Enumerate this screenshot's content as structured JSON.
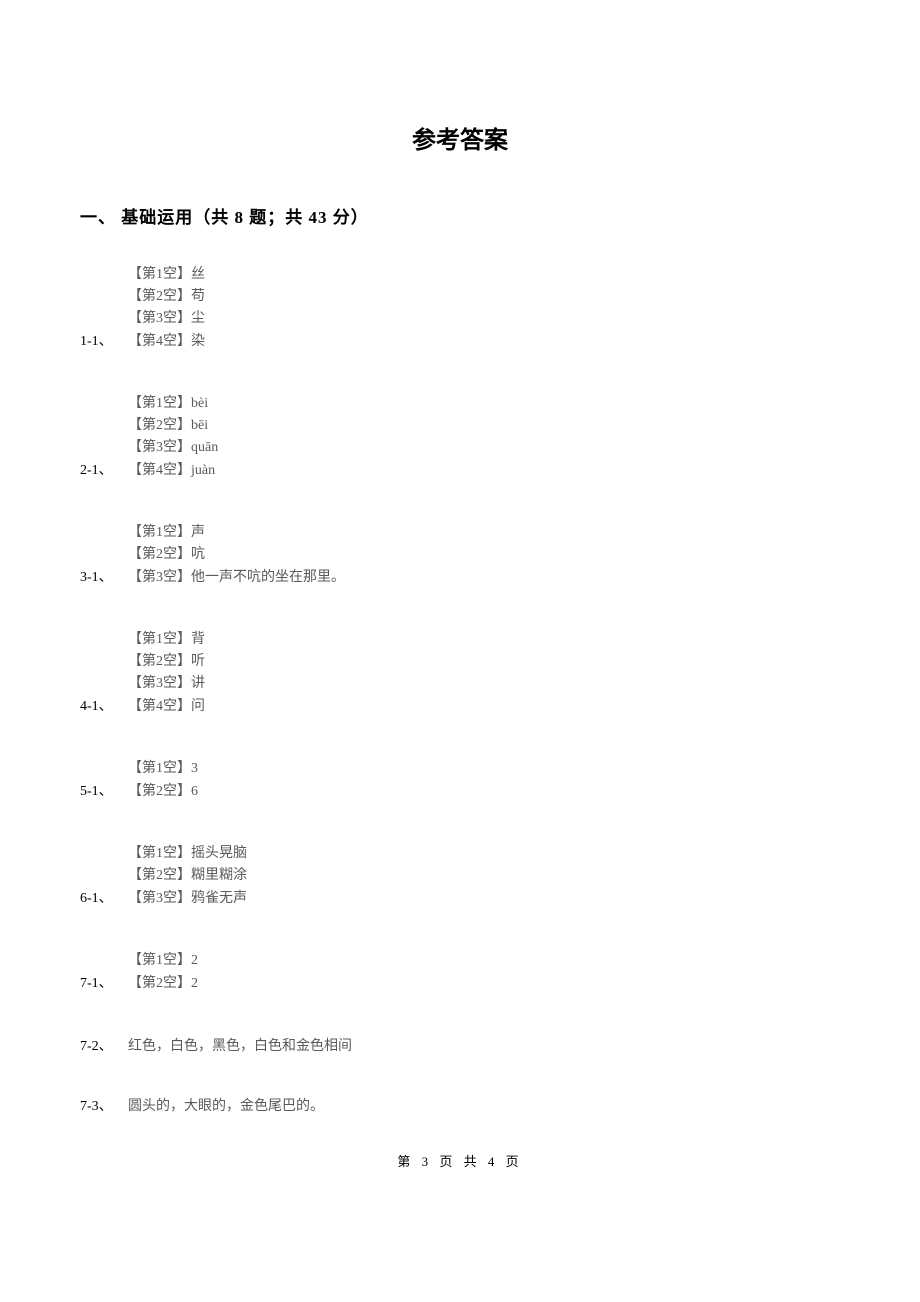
{
  "title": "参考答案",
  "section": {
    "number": "一、",
    "label": "基础运用（共 8 题；共 43 分）"
  },
  "questions": [
    {
      "num": "1-1、",
      "blanks": [
        {
          "label": "【第1空】",
          "value": "丝"
        },
        {
          "label": "【第2空】",
          "value": "苟"
        },
        {
          "label": "【第3空】",
          "value": "尘"
        },
        {
          "label": "【第4空】",
          "value": "染"
        }
      ]
    },
    {
      "num": "2-1、",
      "blanks": [
        {
          "label": "【第1空】",
          "value": "bèi"
        },
        {
          "label": "【第2空】",
          "value": "bēi"
        },
        {
          "label": "【第3空】",
          "value": "quān"
        },
        {
          "label": "【第4空】",
          "value": "juàn"
        }
      ]
    },
    {
      "num": "3-1、",
      "blanks": [
        {
          "label": "【第1空】",
          "value": "声"
        },
        {
          "label": "【第2空】",
          "value": "吭"
        },
        {
          "label": "【第3空】",
          "value": "他一声不吭的坐在那里。"
        }
      ]
    },
    {
      "num": "4-1、",
      "blanks": [
        {
          "label": "【第1空】",
          "value": "背"
        },
        {
          "label": "【第2空】",
          "value": "听"
        },
        {
          "label": "【第3空】",
          "value": "讲"
        },
        {
          "label": "【第4空】",
          "value": "问"
        }
      ]
    },
    {
      "num": "5-1、",
      "blanks": [
        {
          "label": "【第1空】",
          "value": "3"
        },
        {
          "label": "【第2空】",
          "value": "6"
        }
      ]
    },
    {
      "num": "6-1、",
      "blanks": [
        {
          "label": "【第1空】",
          "value": "摇头晃脑"
        },
        {
          "label": "【第2空】",
          "value": "糊里糊涂"
        },
        {
          "label": "【第3空】",
          "value": "鸦雀无声"
        }
      ]
    },
    {
      "num": "7-1、",
      "blanks": [
        {
          "label": "【第1空】",
          "value": "2"
        },
        {
          "label": "【第2空】",
          "value": "2"
        }
      ]
    }
  ],
  "simple_answers": [
    {
      "num": "7-2、",
      "text": "红色，白色，黑色，白色和金色相间"
    },
    {
      "num": "7-3、",
      "text": "圆头的，大眼的，金色尾巴的。"
    }
  ],
  "footer": "第 3 页 共 4 页"
}
